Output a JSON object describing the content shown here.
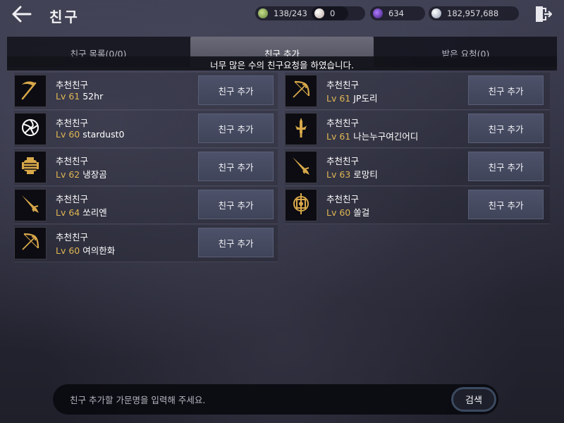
{
  "header": {
    "title": "친구",
    "currencies": [
      {
        "icon": "energy-icon",
        "value": "138/243",
        "color": "#9bbf6a"
      },
      {
        "icon": "pearl-icon",
        "value": "0",
        "color": "#d8c8c0"
      },
      {
        "icon": "dark-orb-icon",
        "value": "634",
        "color": "#7a3fd0"
      },
      {
        "icon": "silver-coin-icon",
        "value": "182,957,688",
        "color": "#cfd8e8"
      }
    ]
  },
  "tabs": [
    {
      "label": "친구 목록(0/0)",
      "active": false
    },
    {
      "label": "친구 추가",
      "active": true
    },
    {
      "label": "받은 요청(0)",
      "active": false
    }
  ],
  "notice": "너무 많은 수의 친구요청을 하였습니다.",
  "friends": [
    {
      "title": "추천친구",
      "level": "Lv 61",
      "name": "52hr",
      "icon": "scythe-icon",
      "button": "친구 추가"
    },
    {
      "title": "추천친구",
      "level": "Lv 61",
      "name": "JP도리",
      "icon": "bow-icon",
      "button": "친구 추가"
    },
    {
      "title": "추천친구",
      "level": "Lv 60",
      "name": "stardust0",
      "icon": "spiral-flower-icon",
      "button": "친구 추가"
    },
    {
      "title": "추천친구",
      "level": "Lv 61",
      "name": "나는누구여긴어디",
      "icon": "sword-icon",
      "button": "친구 추가"
    },
    {
      "title": "추천친구",
      "level": "Lv 62",
      "name": "냉장곰",
      "icon": "gauntlet-icon",
      "button": "친구 추가"
    },
    {
      "title": "추천친구",
      "level": "Lv 63",
      "name": "로망티",
      "icon": "blade-icon",
      "button": "친구 추가"
    },
    {
      "title": "추천친구",
      "level": "Lv 64",
      "name": "쏘리엔",
      "icon": "blade-icon",
      "button": "친구 추가"
    },
    {
      "title": "추천친구",
      "level": "Lv 60",
      "name": "쏠걸",
      "icon": "shield-orb-icon",
      "button": "친구 추가"
    },
    {
      "title": "추천친구",
      "level": "Lv 60",
      "name": "여의한화",
      "icon": "bow-icon",
      "button": "친구 추가"
    }
  ],
  "search": {
    "placeholder": "친구 추가할 가문명을 입력해 주세요.",
    "button": "검색"
  }
}
